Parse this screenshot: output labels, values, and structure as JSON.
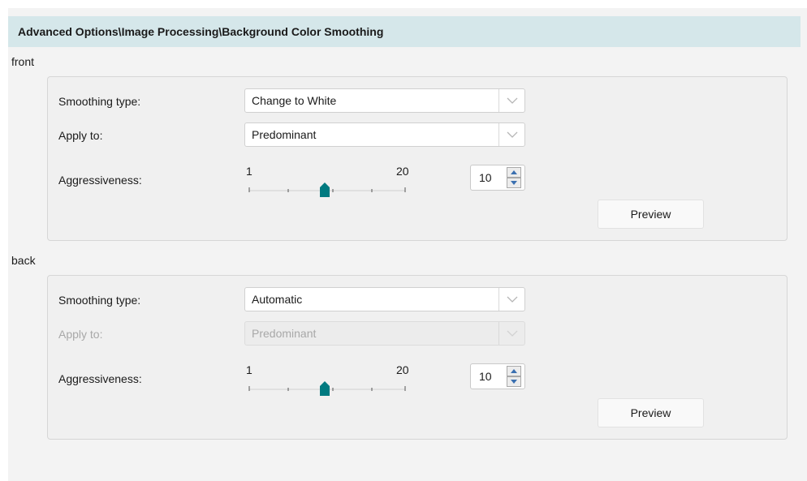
{
  "header": {
    "title": "Advanced Options\\Image Processing\\Background Color Smoothing"
  },
  "front": {
    "section_label": "front",
    "smoothing_type_label": "Smoothing type:",
    "smoothing_type_value": "Change to White",
    "apply_to_label": "Apply to:",
    "apply_to_value": "Predominant",
    "aggressiveness_label": "Aggressiveness:",
    "slider_min": "1",
    "slider_max": "20",
    "aggressiveness_value": "10",
    "preview_label": "Preview"
  },
  "back": {
    "section_label": "back",
    "smoothing_type_label": "Smoothing type:",
    "smoothing_type_value": "Automatic",
    "apply_to_label": "Apply to:",
    "apply_to_value": "Predominant",
    "apply_to_disabled": true,
    "aggressiveness_label": "Aggressiveness:",
    "slider_min": "1",
    "slider_max": "20",
    "aggressiveness_value": "10",
    "preview_label": "Preview"
  },
  "colors": {
    "header_bg": "#d5e7ea",
    "slider_thumb": "#007a80"
  },
  "icons": [
    "chevron-down-icon",
    "spin-up-icon",
    "spin-down-icon",
    "slider-thumb-icon"
  ]
}
